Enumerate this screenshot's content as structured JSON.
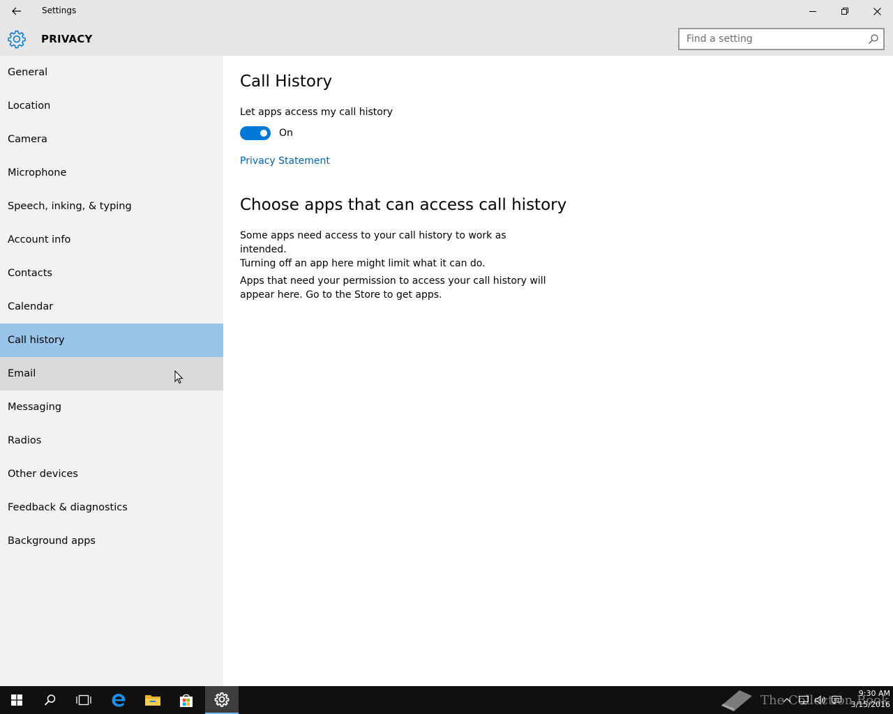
{
  "window": {
    "title": "Settings"
  },
  "header": {
    "title": "PRIVACY",
    "search_placeholder": "Find a setting"
  },
  "sidebar": {
    "items": [
      {
        "label": "General"
      },
      {
        "label": "Location"
      },
      {
        "label": "Camera"
      },
      {
        "label": "Microphone"
      },
      {
        "label": "Speech, inking, & typing"
      },
      {
        "label": "Account info"
      },
      {
        "label": "Contacts"
      },
      {
        "label": "Calendar"
      },
      {
        "label": "Call history",
        "selected": true
      },
      {
        "label": "Email",
        "hovered": true
      },
      {
        "label": "Messaging"
      },
      {
        "label": "Radios"
      },
      {
        "label": "Other devices"
      },
      {
        "label": "Feedback & diagnostics"
      },
      {
        "label": "Background apps"
      }
    ]
  },
  "main": {
    "title": "Call History",
    "toggle_label": "Let apps access my call history",
    "toggle_state": "On",
    "toggle_on": true,
    "privacy_link": "Privacy Statement",
    "section_title": "Choose apps that can access call history",
    "paragraph1_line1": "Some apps need access to your call history to work as intended.",
    "paragraph1_line2": "Turning off an app here might limit what it can do.",
    "paragraph2_line1": "Apps that need your permission to access your call history will",
    "paragraph2_line2": "appear here. Go to the Store to get apps."
  },
  "taskbar": {
    "time": "9:30 AM",
    "date": "3/15/2016",
    "watermark": "The Collection Book",
    "apps": [
      "start-icon",
      "search-icon",
      "task-view-icon",
      "edge-icon",
      "file-explorer-icon",
      "store-icon",
      "settings-icon"
    ]
  },
  "colors": {
    "accent": "#0078d7",
    "selected_item": "#99c4ea",
    "hover_item": "#dadada",
    "link": "#0063b1",
    "sidebar_bg": "#f2f2f2",
    "header_bg": "#e6e6e6"
  }
}
